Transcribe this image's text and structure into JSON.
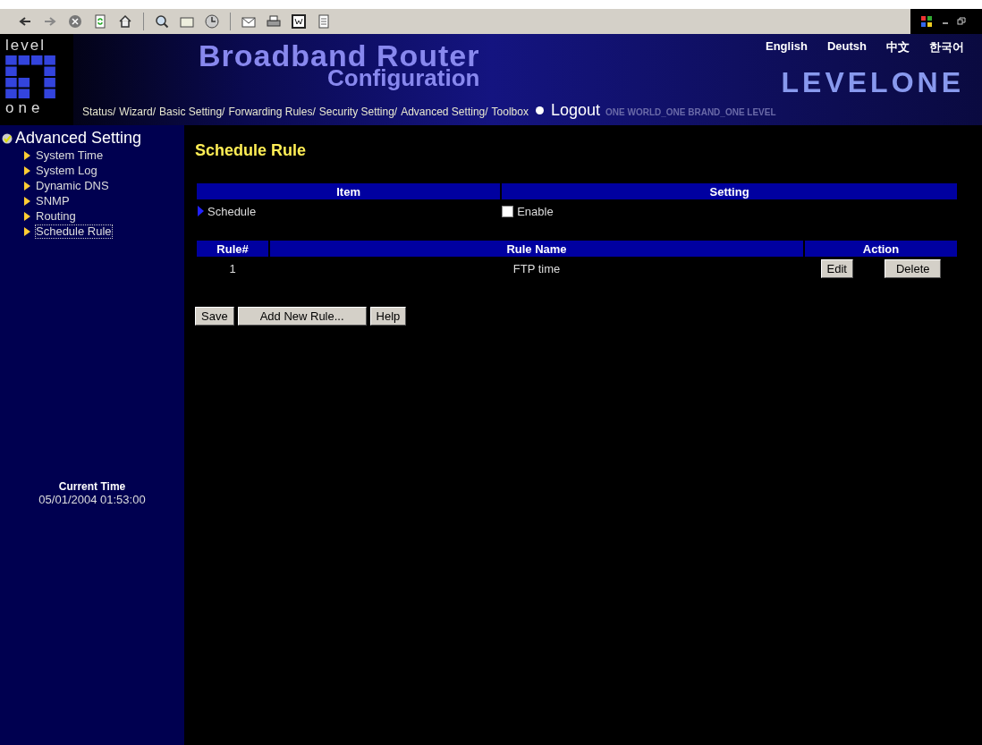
{
  "header": {
    "logo_top": "level",
    "logo_bottom": "one",
    "title": "Broadband Router",
    "subtitle": "Configuration",
    "brand": "LEVELONE",
    "tagline": "ONE WORLD_ONE BRAND_ONE LEVEL",
    "nav": [
      "Status/",
      "Wizard/",
      "Basic Setting/",
      "Forwarding Rules/",
      "Security Setting/",
      "Advanced Setting/",
      "Toolbox"
    ],
    "logout": "Logout",
    "languages": [
      "English",
      "Deutsh",
      "中文",
      "한국어"
    ]
  },
  "sidebar": {
    "heading": "Advanced Setting",
    "items": [
      {
        "label": "System Time",
        "selected": false
      },
      {
        "label": "System Log",
        "selected": false
      },
      {
        "label": "Dynamic DNS",
        "selected": false
      },
      {
        "label": "SNMP",
        "selected": false
      },
      {
        "label": "Routing",
        "selected": false
      },
      {
        "label": "Schedule Rule",
        "selected": true
      }
    ],
    "time_label": "Current Time",
    "time_value": "05/01/2004 01:53:00"
  },
  "main": {
    "title": "Schedule Rule",
    "settings_table": {
      "columns": [
        "Item",
        "Setting"
      ],
      "rows": [
        {
          "item": "Schedule",
          "option": "Enable",
          "checked": false
        }
      ]
    },
    "rules_table": {
      "columns": [
        "Rule#",
        "Rule Name",
        "Action"
      ],
      "rows": [
        {
          "number": "1",
          "name": "FTP time",
          "actions": [
            "Edit",
            "Delete"
          ]
        }
      ]
    },
    "buttons": [
      "Save",
      "Add New Rule...",
      "Help"
    ]
  }
}
